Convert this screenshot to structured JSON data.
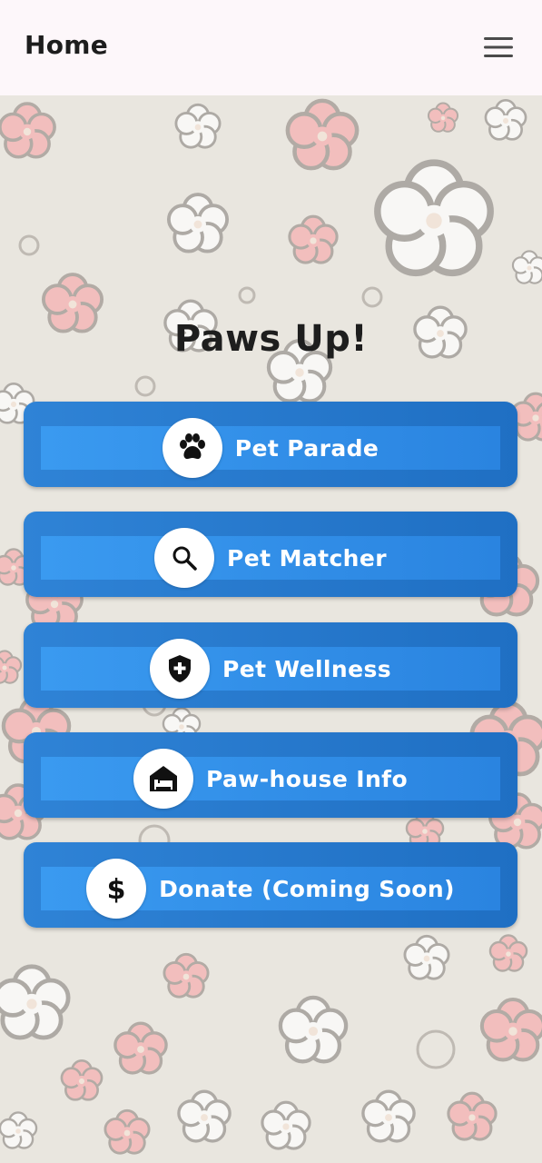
{
  "appbar": {
    "title": "Home",
    "menu_icon": "hamburger-menu-icon",
    "background": "#fdf7fa"
  },
  "main": {
    "headline": "Paws Up!",
    "buttons": [
      {
        "label": "Pet Parade",
        "icon": "paw-icon"
      },
      {
        "label": "Pet Matcher",
        "icon": "search-icon"
      },
      {
        "label": "Pet Wellness",
        "icon": "shield-plus-icon"
      },
      {
        "label": "Paw-house Info",
        "icon": "house-bed-icon"
      },
      {
        "label": "Donate (Coming Soon)",
        "icon": "dollar-icon"
      }
    ]
  },
  "colors": {
    "button_outer": "#1f6fc3",
    "button_inner": "#3a9af0",
    "background": "#e9e6df",
    "flower_pink": "#f2b7b7",
    "flower_white": "#fafafa"
  }
}
